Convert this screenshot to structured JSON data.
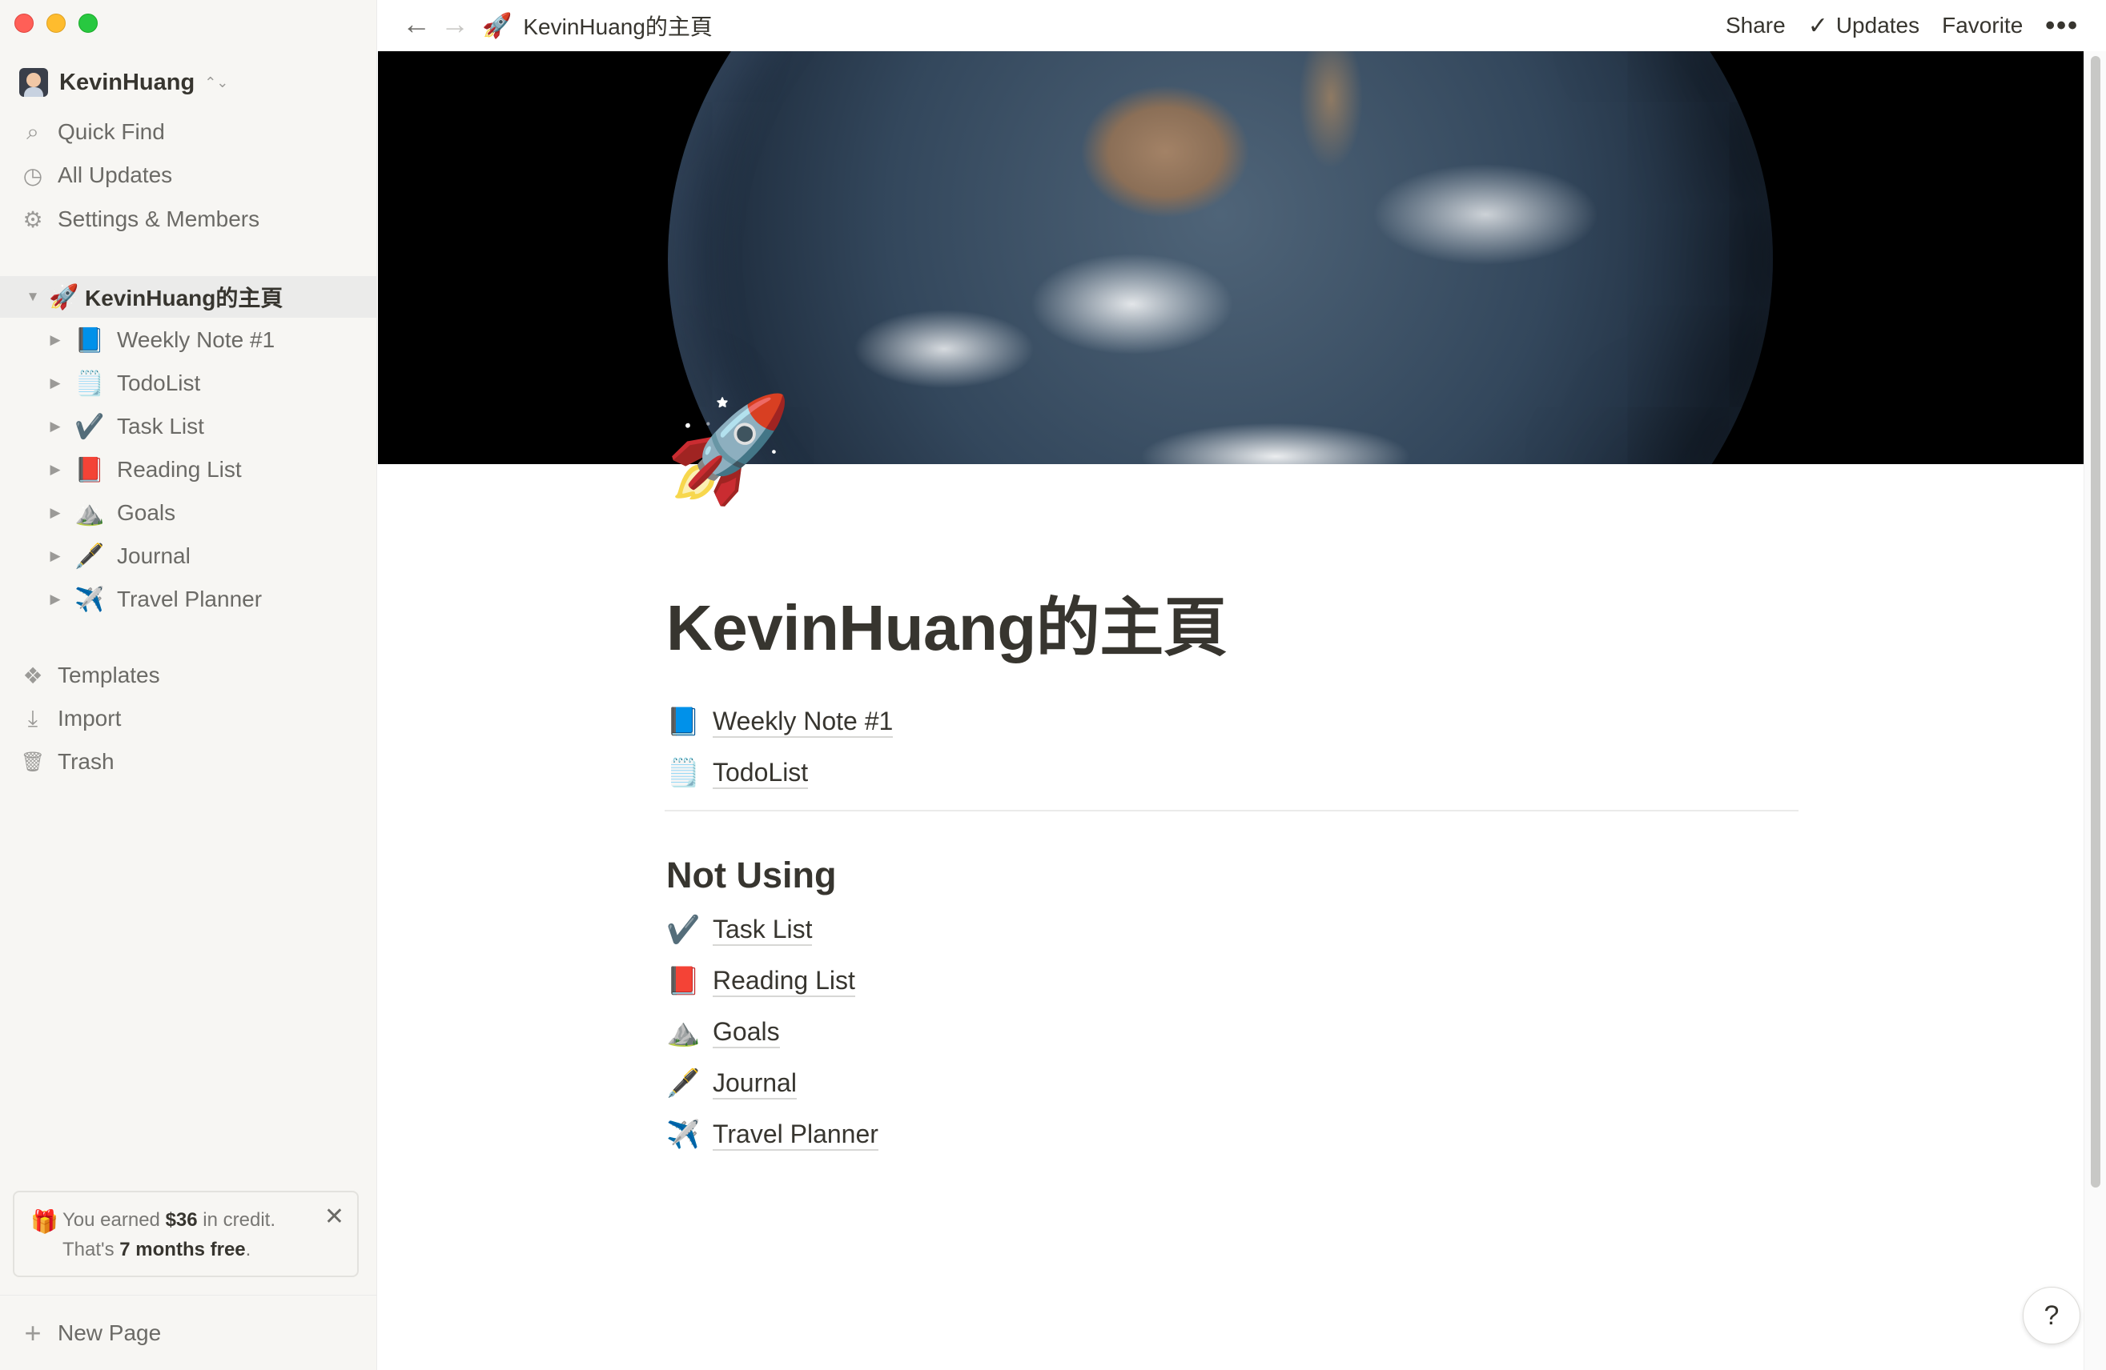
{
  "sidebar": {
    "workspace_name": "KevinHuang",
    "workspace_chevron": "⌃⌄",
    "nav": [
      {
        "icon": "search-icon",
        "glyph": "⌕",
        "label": "Quick Find"
      },
      {
        "icon": "clock-icon",
        "glyph": "◷",
        "label": "All Updates"
      },
      {
        "icon": "gear-icon",
        "glyph": "⚙",
        "label": "Settings & Members"
      }
    ],
    "pages": [
      {
        "caret": "▼",
        "emoji": "🚀",
        "label": "KevinHuang的主頁"
      },
      {
        "caret": "▶",
        "emoji": "📘",
        "label": "Weekly Note #1"
      },
      {
        "caret": "▶",
        "emoji": "🗒️",
        "label": "TodoList"
      },
      {
        "caret": "▶",
        "emoji": "✔️",
        "label": "Task List"
      },
      {
        "caret": "▶",
        "emoji": "📕",
        "label": "Reading List"
      },
      {
        "caret": "▶",
        "emoji": "⛰️",
        "label": "Goals"
      },
      {
        "caret": "▶",
        "emoji": "🖋️",
        "label": "Journal"
      },
      {
        "caret": "▶",
        "emoji": "✈️",
        "label": "Travel Planner"
      }
    ],
    "tools": [
      {
        "icon": "templates-icon",
        "glyph": "❖",
        "label": "Templates"
      },
      {
        "icon": "import-icon",
        "glyph": "⤓",
        "label": "Import"
      },
      {
        "icon": "trash-icon",
        "glyph": "🗑",
        "label": "Trash"
      }
    ],
    "credit": {
      "line1_prefix": "You earned ",
      "amount": "$36",
      "line1_suffix": " in credit.",
      "line2_prefix": "That's ",
      "free": "7 months free",
      "line2_suffix": ".",
      "gift_glyph": "🎁",
      "close_glyph": "✕"
    },
    "new_page_label": "New Page",
    "new_page_glyph": "+"
  },
  "topbar": {
    "back_glyph": "←",
    "forward_glyph": "→",
    "breadcrumb_emoji": "🚀",
    "breadcrumb_title": "KevinHuang的主頁",
    "share_label": "Share",
    "updates_check": "✓",
    "updates_label": "Updates",
    "favorite_label": "Favorite",
    "more_glyph": "•••"
  },
  "page": {
    "icon": "🚀",
    "title": "KevinHuang的主頁",
    "top_links": [
      {
        "emoji": "📘",
        "label": "Weekly Note #1"
      },
      {
        "emoji": "🗒️",
        "label": "TodoList"
      }
    ],
    "section_heading": "Not Using",
    "section_links": [
      {
        "emoji": "✔️",
        "label": "Task List"
      },
      {
        "emoji": "📕",
        "label": "Reading List"
      },
      {
        "emoji": "⛰️",
        "label": "Goals"
      },
      {
        "emoji": "🖋️",
        "label": "Journal"
      },
      {
        "emoji": "✈️",
        "label": "Travel Planner"
      }
    ],
    "help_glyph": "?"
  },
  "colors": {
    "sidebar_bg": "#f7f6f3",
    "text": "#37352f",
    "muted": "#6b6a66",
    "close_red": "#ff5f57",
    "minimize_yellow": "#febc2e",
    "zoom_green": "#28c840"
  }
}
